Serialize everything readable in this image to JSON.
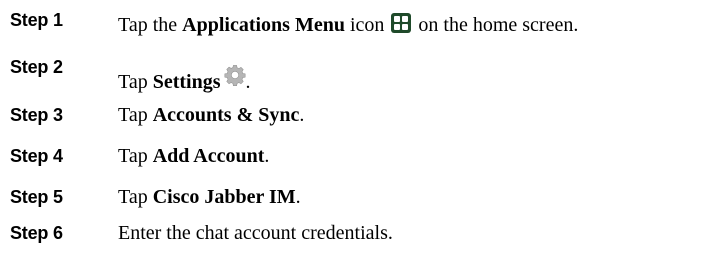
{
  "steps": [
    {
      "label": "Step 1",
      "parts": {
        "pre": "Tap the ",
        "bold": "Applications Menu",
        "post1": " icon",
        "post2": " on the home screen."
      }
    },
    {
      "label": "Step 2",
      "parts": {
        "pre": "Tap ",
        "bold": "Settings",
        "post": "."
      }
    },
    {
      "label": "Step 3",
      "parts": {
        "pre": "Tap ",
        "bold": "Accounts & Sync",
        "post": "."
      }
    },
    {
      "label": "Step 4",
      "parts": {
        "pre": "Tap ",
        "bold": "Add Account",
        "post": "."
      }
    },
    {
      "label": "Step 5",
      "parts": {
        "pre": "Tap ",
        "bold": "Cisco Jabber IM",
        "post": "."
      }
    },
    {
      "label": "Step 6",
      "parts": {
        "text": "Enter the chat account credentials."
      }
    }
  ],
  "icons": {
    "applications_menu": "apps-grid-icon",
    "settings": "gear-icon"
  },
  "colors": {
    "text": "#000000",
    "apps_icon_bg": "#1f4a2a",
    "gear": "#a9a9a9"
  }
}
